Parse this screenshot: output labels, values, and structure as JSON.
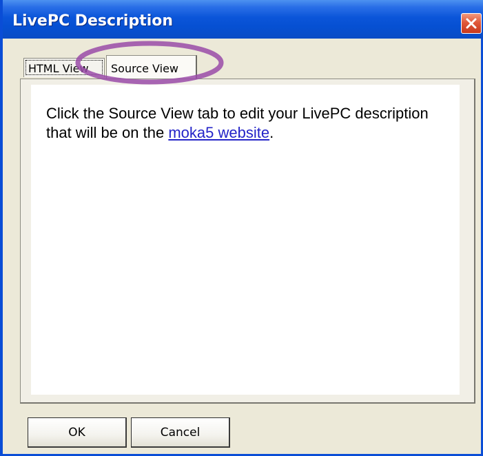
{
  "window": {
    "title": "LivePC Description"
  },
  "tabs": [
    {
      "label": "HTML View"
    },
    {
      "label": "Source View"
    }
  ],
  "content": {
    "text_before_link": "Click the Source View tab to edit your LivePC description that will be on the ",
    "link_text": "moka5 website",
    "text_after_link": "."
  },
  "buttons": {
    "ok_label": "OK",
    "cancel_label": "Cancel"
  },
  "colors": {
    "titlebar": "#0650d2",
    "highlight_ellipse": "#9a4ba8",
    "link": "#2323c8",
    "dialog_face": "#ece9d8"
  },
  "icons": {
    "close": "close-icon"
  }
}
